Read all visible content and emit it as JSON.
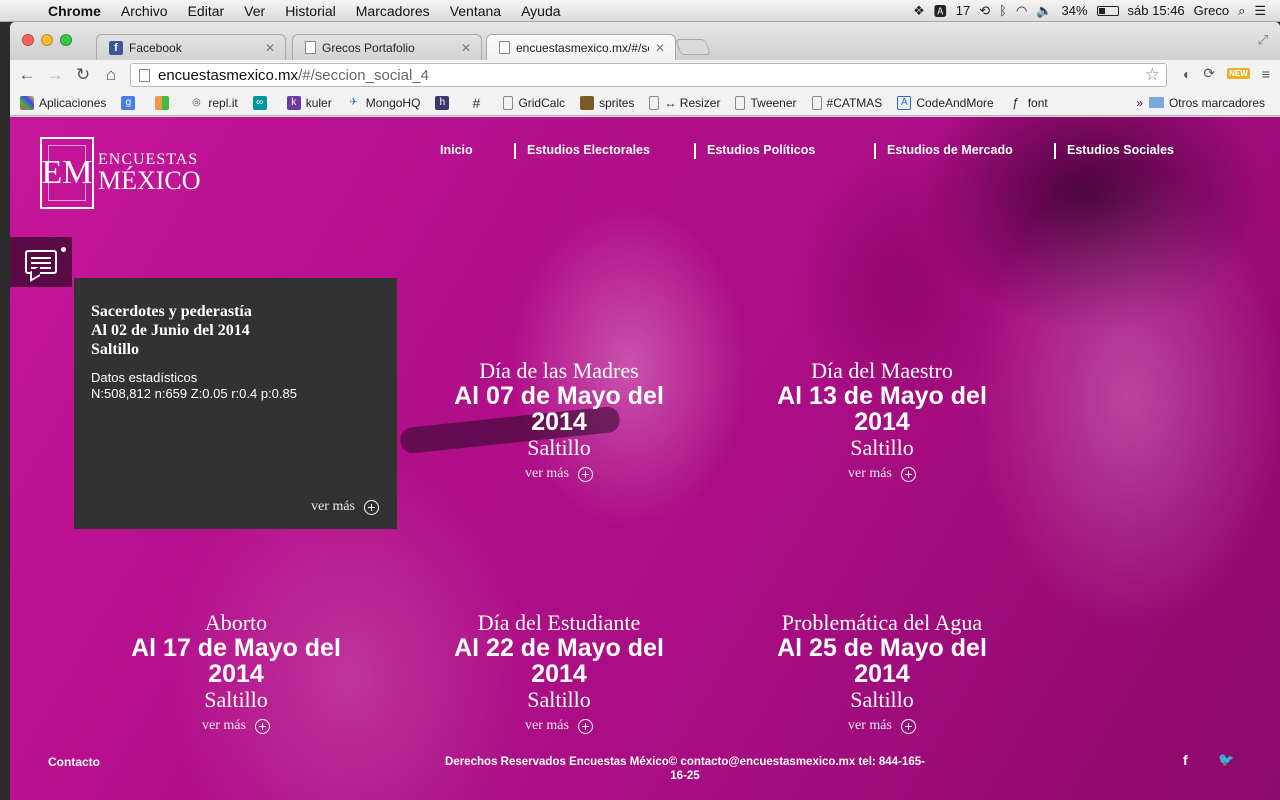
{
  "menubar": {
    "app": "Chrome",
    "items": [
      "Archivo",
      "Editar",
      "Ver",
      "Historial",
      "Marcadores",
      "Ventana",
      "Ayuda"
    ],
    "status": {
      "adobe_count": "17",
      "battery": "34%",
      "clock": "sáb 15:46",
      "user": "Greco"
    }
  },
  "tabs": [
    {
      "label": "Facebook",
      "favicon": "facebook-icon"
    },
    {
      "label": "Grecos Portafolio",
      "favicon": "page-icon"
    },
    {
      "label": "encuestasmexico.mx/#/se",
      "favicon": "page-icon",
      "active": true
    }
  ],
  "omnibox": {
    "host": "encuestasmexico.mx",
    "path": "/#/seccion_social_4"
  },
  "extensions": {
    "new_badge": "NEW"
  },
  "bookmarks": {
    "items": [
      "Aplicaciones",
      "",
      "",
      "repl.it",
      "",
      "kuler",
      "MongoHQ",
      "",
      "",
      "GridCalc",
      "sprites",
      "↔ Resizer",
      "Tweener",
      "#CATMAS",
      "CodeAndMore",
      "font"
    ],
    "more": "»",
    "other": "Otros marcadores"
  },
  "site": {
    "logo": {
      "monogram": "EM",
      "line1": "ENCUESTAS",
      "line2": "MÉXICO"
    },
    "nav": [
      "Inicio",
      "Estudios Electorales",
      "Estudios Políticos",
      "Estudios de Mercado",
      "Estudios Sociales"
    ],
    "info_card": {
      "title": "Sacerdotes y pederastía",
      "date": "Al 02 de Junio del 2014",
      "city": "Saltillo",
      "stats_label": "Datos estadísticos",
      "stats_values": "N:508,812 n:659 Z:0.05 r:0.4 p:0.85",
      "more": "ver más"
    },
    "studies": [
      {
        "title": "Día de las Madres",
        "date": "Al 07 de Mayo del 2014",
        "city": "Saltillo",
        "more": "ver más"
      },
      {
        "title": "Día del Maestro",
        "date": "Al 13 de Mayo del 2014",
        "city": "Saltillo",
        "more": "ver más"
      },
      {
        "title": "Aborto",
        "date": "Al 17 de Mayo del 2014",
        "city": "Saltillo",
        "more": "ver más"
      },
      {
        "title": "Día del Estudiante",
        "date": "Al 22 de Mayo del 2014",
        "city": "Saltillo",
        "more": "ver más"
      },
      {
        "title": "Problemática del Agua",
        "date": "Al 25 de Mayo del 2014",
        "city": "Saltillo",
        "more": "ver más"
      }
    ],
    "footer": {
      "contact": "Contacto",
      "rights": "Derechos Reservados Encuestas México© contacto@encuestasmexico.mx tel: 844-165-16-25",
      "facebook": "f",
      "twitter": "🐦"
    }
  },
  "colors": {
    "background_magenta": "#b10f8a",
    "card": "#323232",
    "side_tab": "#5a0b46"
  }
}
